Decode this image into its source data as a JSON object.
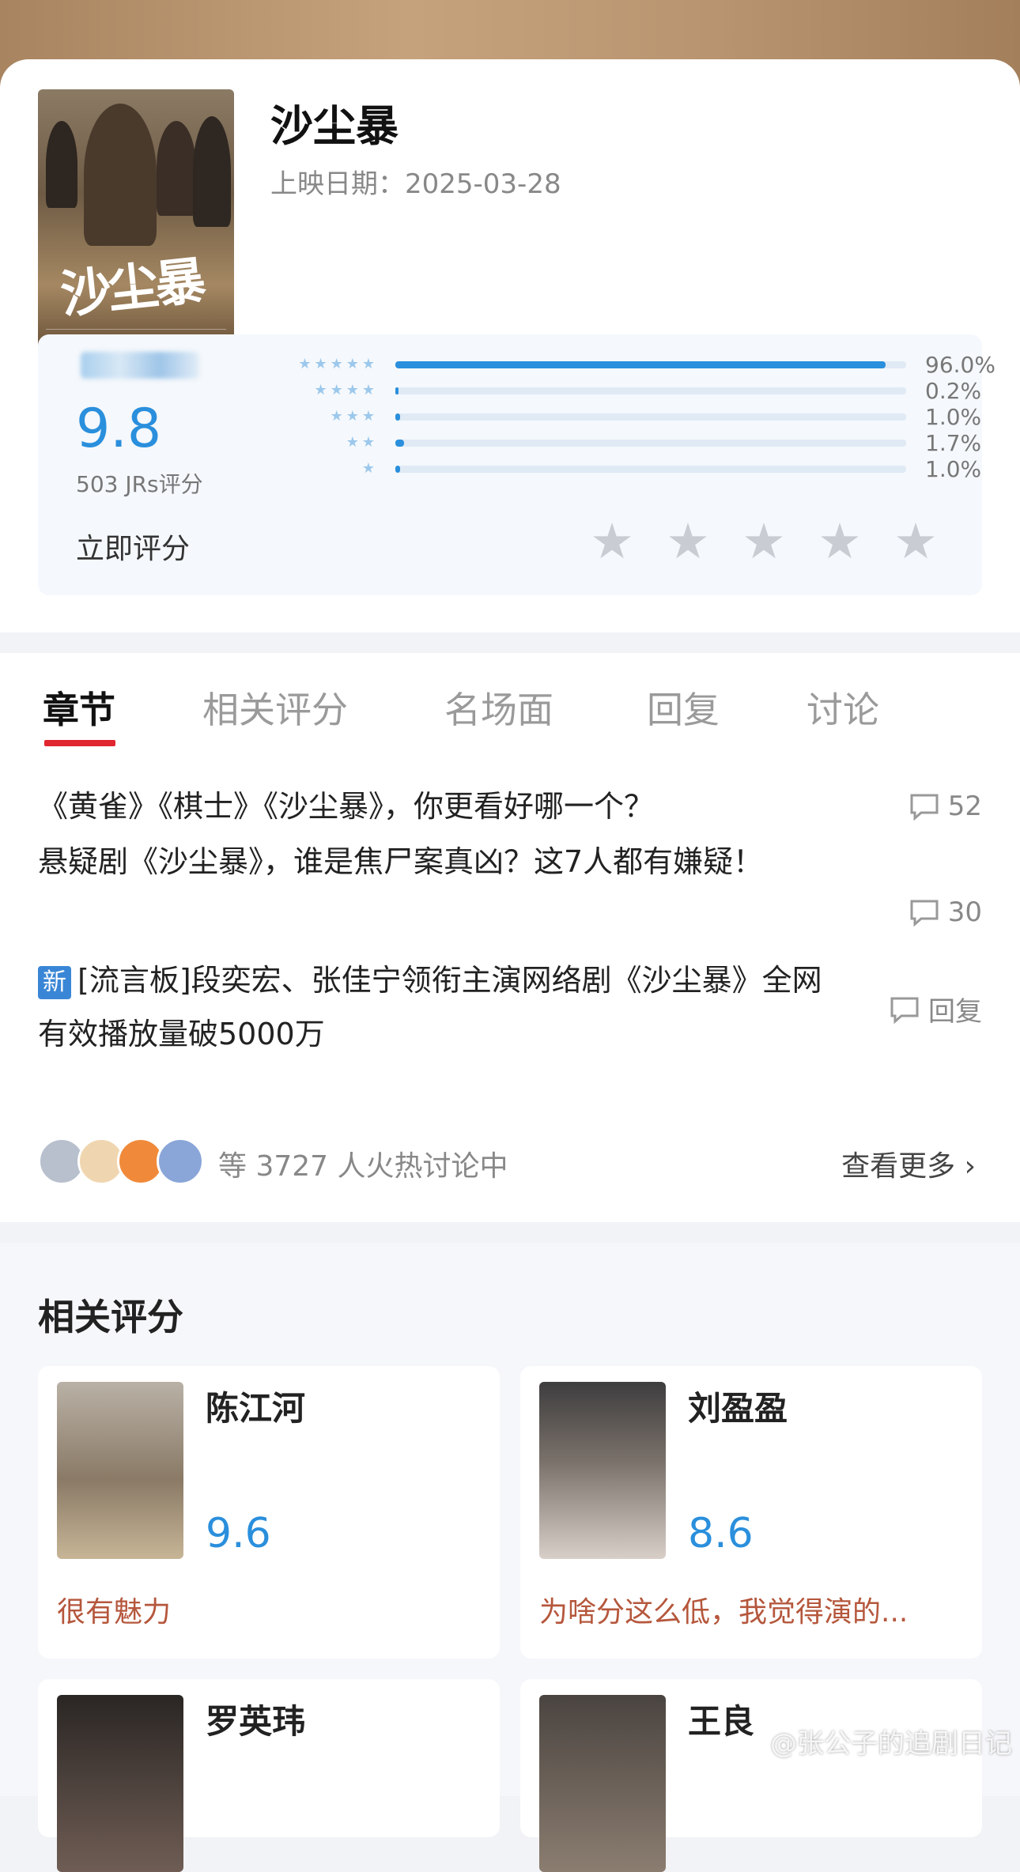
{
  "show": {
    "title": "沙尘暴",
    "release_label": "上映日期：",
    "release_date": "2025-03-28",
    "poster_title": "沙尘暴"
  },
  "rating": {
    "score": "9.8",
    "count_text": "503 JRs评分",
    "rate_now": "立即评分",
    "distribution": [
      {
        "stars": 5,
        "percent": 96.0,
        "label": "96.0%"
      },
      {
        "stars": 4,
        "percent": 0.2,
        "label": "0.2%"
      },
      {
        "stars": 3,
        "percent": 1.0,
        "label": "1.0%"
      },
      {
        "stars": 2,
        "percent": 1.7,
        "label": "1.7%"
      },
      {
        "stars": 1,
        "percent": 1.0,
        "label": "1.0%"
      }
    ],
    "accent": "#2a8fdc"
  },
  "tabs": [
    "章节",
    "相关评分",
    "名场面",
    "回复",
    "讨论"
  ],
  "threads": [
    {
      "title": "《黄雀》《棋士》《沙尘暴》，你更看好哪一个？",
      "comments": "52"
    },
    {
      "title": "悬疑剧《沙尘暴》，谁是焦尸案真凶？这7人都有嫌疑！",
      "comments": "30"
    },
    {
      "badge": "新",
      "title": "[流言板]段奕宏、张佳宁领衔主演网络剧《沙尘暴》全网有效播放量破5000万",
      "comments": "回复"
    }
  ],
  "discussion": {
    "text": "等 3727 人火热讨论中",
    "more": "查看更多"
  },
  "related": {
    "title": "相关评分",
    "items": [
      {
        "name": "陈江河",
        "score": "9.6",
        "quote": "很有魅力"
      },
      {
        "name": "刘盈盈",
        "score": "8.6",
        "quote": "为啥分这么低，我觉得演的..."
      },
      {
        "name": "罗英玮",
        "score": "",
        "quote": ""
      },
      {
        "name": "王良",
        "score": "",
        "quote": ""
      }
    ]
  },
  "watermark": "@张公子的追剧日记"
}
